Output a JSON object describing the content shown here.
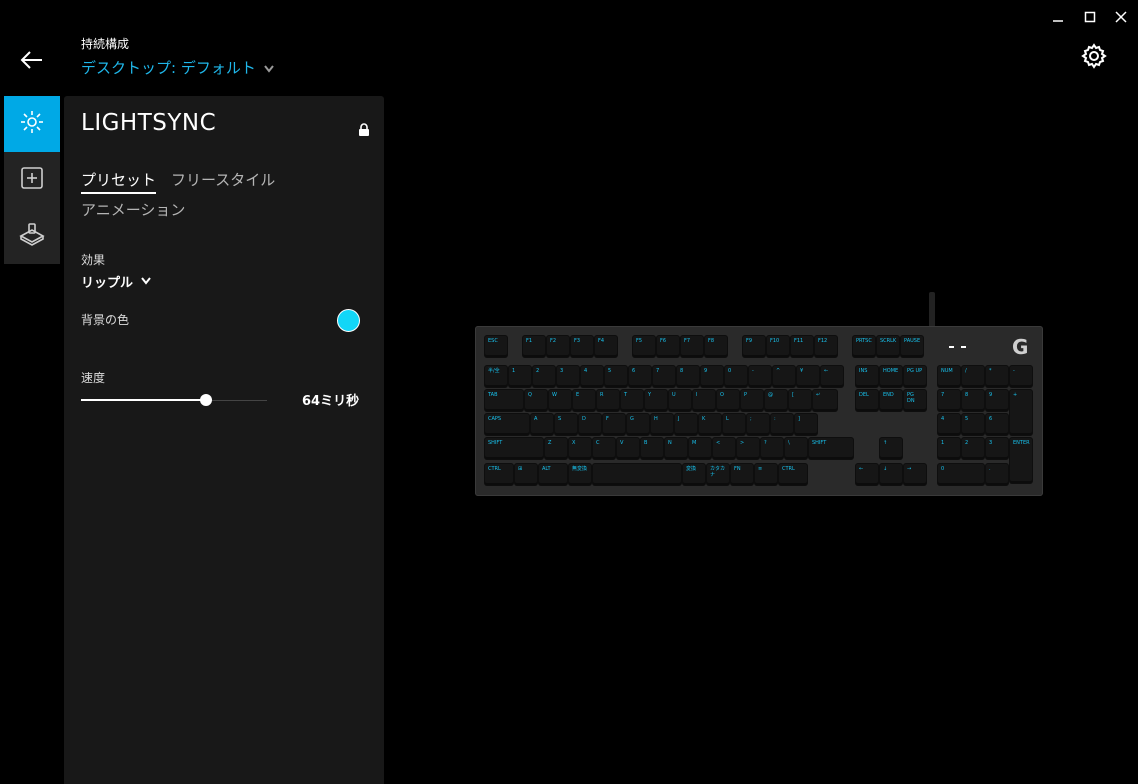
{
  "window": {
    "minimize_icon": "minimize-icon",
    "maximize_icon": "maximize-icon",
    "close_icon": "close-icon"
  },
  "header": {
    "back_icon": "back-arrow-icon",
    "profile_label": "持続構成",
    "profile_value": "デスクトップ: デフォルト",
    "settings_icon": "gear-icon"
  },
  "nav": {
    "items": [
      {
        "icon": "lightsync-icon",
        "active": true
      },
      {
        "icon": "assignments-icon",
        "active": false
      },
      {
        "icon": "game-mode-icon",
        "active": false
      }
    ]
  },
  "panel": {
    "title": "LIGHTSYNC",
    "tabs": {
      "preset": "プリセット",
      "freestyle": "フリースタイル",
      "animation": "アニメーション"
    },
    "effect_label": "効果",
    "effect_value": "リップル",
    "bgcolor_label": "背景の色",
    "bgcolor_value": "#12d6f7",
    "speed_label": "速度",
    "speed_value": "64ミリ秒",
    "speed_fraction": 0.67
  },
  "colors": {
    "accent": "#00a9e6",
    "link": "#1fb7ea",
    "key_legend": "#18c4f0"
  },
  "keyboard": {
    "logo": "G",
    "rows": [
      {
        "keys": [
          {
            "label": "ESC"
          },
          {
            "label": "F1",
            "gap": true
          },
          {
            "label": "F2"
          },
          {
            "label": "F3"
          },
          {
            "label": "F4"
          },
          {
            "label": "F5",
            "gap": true
          },
          {
            "label": "F6"
          },
          {
            "label": "F7"
          },
          {
            "label": "F8"
          },
          {
            "label": "F9",
            "gap": true
          },
          {
            "label": "F10"
          },
          {
            "label": "F11"
          },
          {
            "label": "F12"
          },
          {
            "label": "PRTSC",
            "gap": true
          },
          {
            "label": "SCRLK"
          },
          {
            "label": "PAUSE"
          }
        ]
      },
      {
        "keys": [
          {
            "label": "半/全"
          },
          {
            "label": "1"
          },
          {
            "label": "2"
          },
          {
            "label": "3"
          },
          {
            "label": "4"
          },
          {
            "label": "5"
          },
          {
            "label": "6"
          },
          {
            "label": "7"
          },
          {
            "label": "8"
          },
          {
            "label": "9"
          },
          {
            "label": "0"
          },
          {
            "label": "-"
          },
          {
            "label": "^"
          },
          {
            "label": "¥"
          },
          {
            "label": "←"
          },
          {
            "label": "INS",
            "gap": true
          },
          {
            "label": "HOME"
          },
          {
            "label": "PG UP"
          },
          {
            "label": "NUM",
            "gap": true
          },
          {
            "label": "/"
          },
          {
            "label": "*"
          },
          {
            "label": "-"
          }
        ]
      },
      {
        "keys": [
          {
            "label": "TAB"
          },
          {
            "label": "Q"
          },
          {
            "label": "W"
          },
          {
            "label": "E"
          },
          {
            "label": "R"
          },
          {
            "label": "T"
          },
          {
            "label": "Y"
          },
          {
            "label": "U"
          },
          {
            "label": "I"
          },
          {
            "label": "O"
          },
          {
            "label": "P"
          },
          {
            "label": "@"
          },
          {
            "label": "["
          },
          {
            "label": "↵"
          },
          {
            "label": "DEL",
            "gap": true
          },
          {
            "label": "END"
          },
          {
            "label": "PG DN"
          },
          {
            "label": "7",
            "gap": true
          },
          {
            "label": "8"
          },
          {
            "label": "9"
          },
          {
            "label": "+"
          }
        ]
      },
      {
        "keys": [
          {
            "label": "CAPS"
          },
          {
            "label": "A"
          },
          {
            "label": "S"
          },
          {
            "label": "D"
          },
          {
            "label": "F"
          },
          {
            "label": "G"
          },
          {
            "label": "H"
          },
          {
            "label": "J"
          },
          {
            "label": "K"
          },
          {
            "label": "L"
          },
          {
            "label": ";"
          },
          {
            "label": ":"
          },
          {
            "label": "]"
          },
          {
            "label": "4",
            "gap": true
          },
          {
            "label": "5"
          },
          {
            "label": "6"
          }
        ]
      },
      {
        "keys": [
          {
            "label": "SHIFT"
          },
          {
            "label": "Z"
          },
          {
            "label": "X"
          },
          {
            "label": "C"
          },
          {
            "label": "V"
          },
          {
            "label": "B"
          },
          {
            "label": "N"
          },
          {
            "label": "M"
          },
          {
            "label": "<"
          },
          {
            "label": ">"
          },
          {
            "label": "?"
          },
          {
            "label": "\\"
          },
          {
            "label": "SHIFT"
          },
          {
            "label": "↑",
            "gap": true
          },
          {
            "label": "1",
            "gap": true
          },
          {
            "label": "2"
          },
          {
            "label": "3"
          },
          {
            "label": "ENTER"
          }
        ]
      },
      {
        "keys": [
          {
            "label": "CTRL"
          },
          {
            "label": "⊞"
          },
          {
            "label": "ALT"
          },
          {
            "label": "無変換"
          },
          {
            "label": ""
          },
          {
            "label": "変換"
          },
          {
            "label": "カタカナ"
          },
          {
            "label": "FN"
          },
          {
            "label": "≡"
          },
          {
            "label": "CTRL"
          },
          {
            "label": "←",
            "gap": true
          },
          {
            "label": "↓"
          },
          {
            "label": "→"
          },
          {
            "label": "0",
            "gap": true
          },
          {
            "label": "."
          }
        ]
      }
    ]
  }
}
